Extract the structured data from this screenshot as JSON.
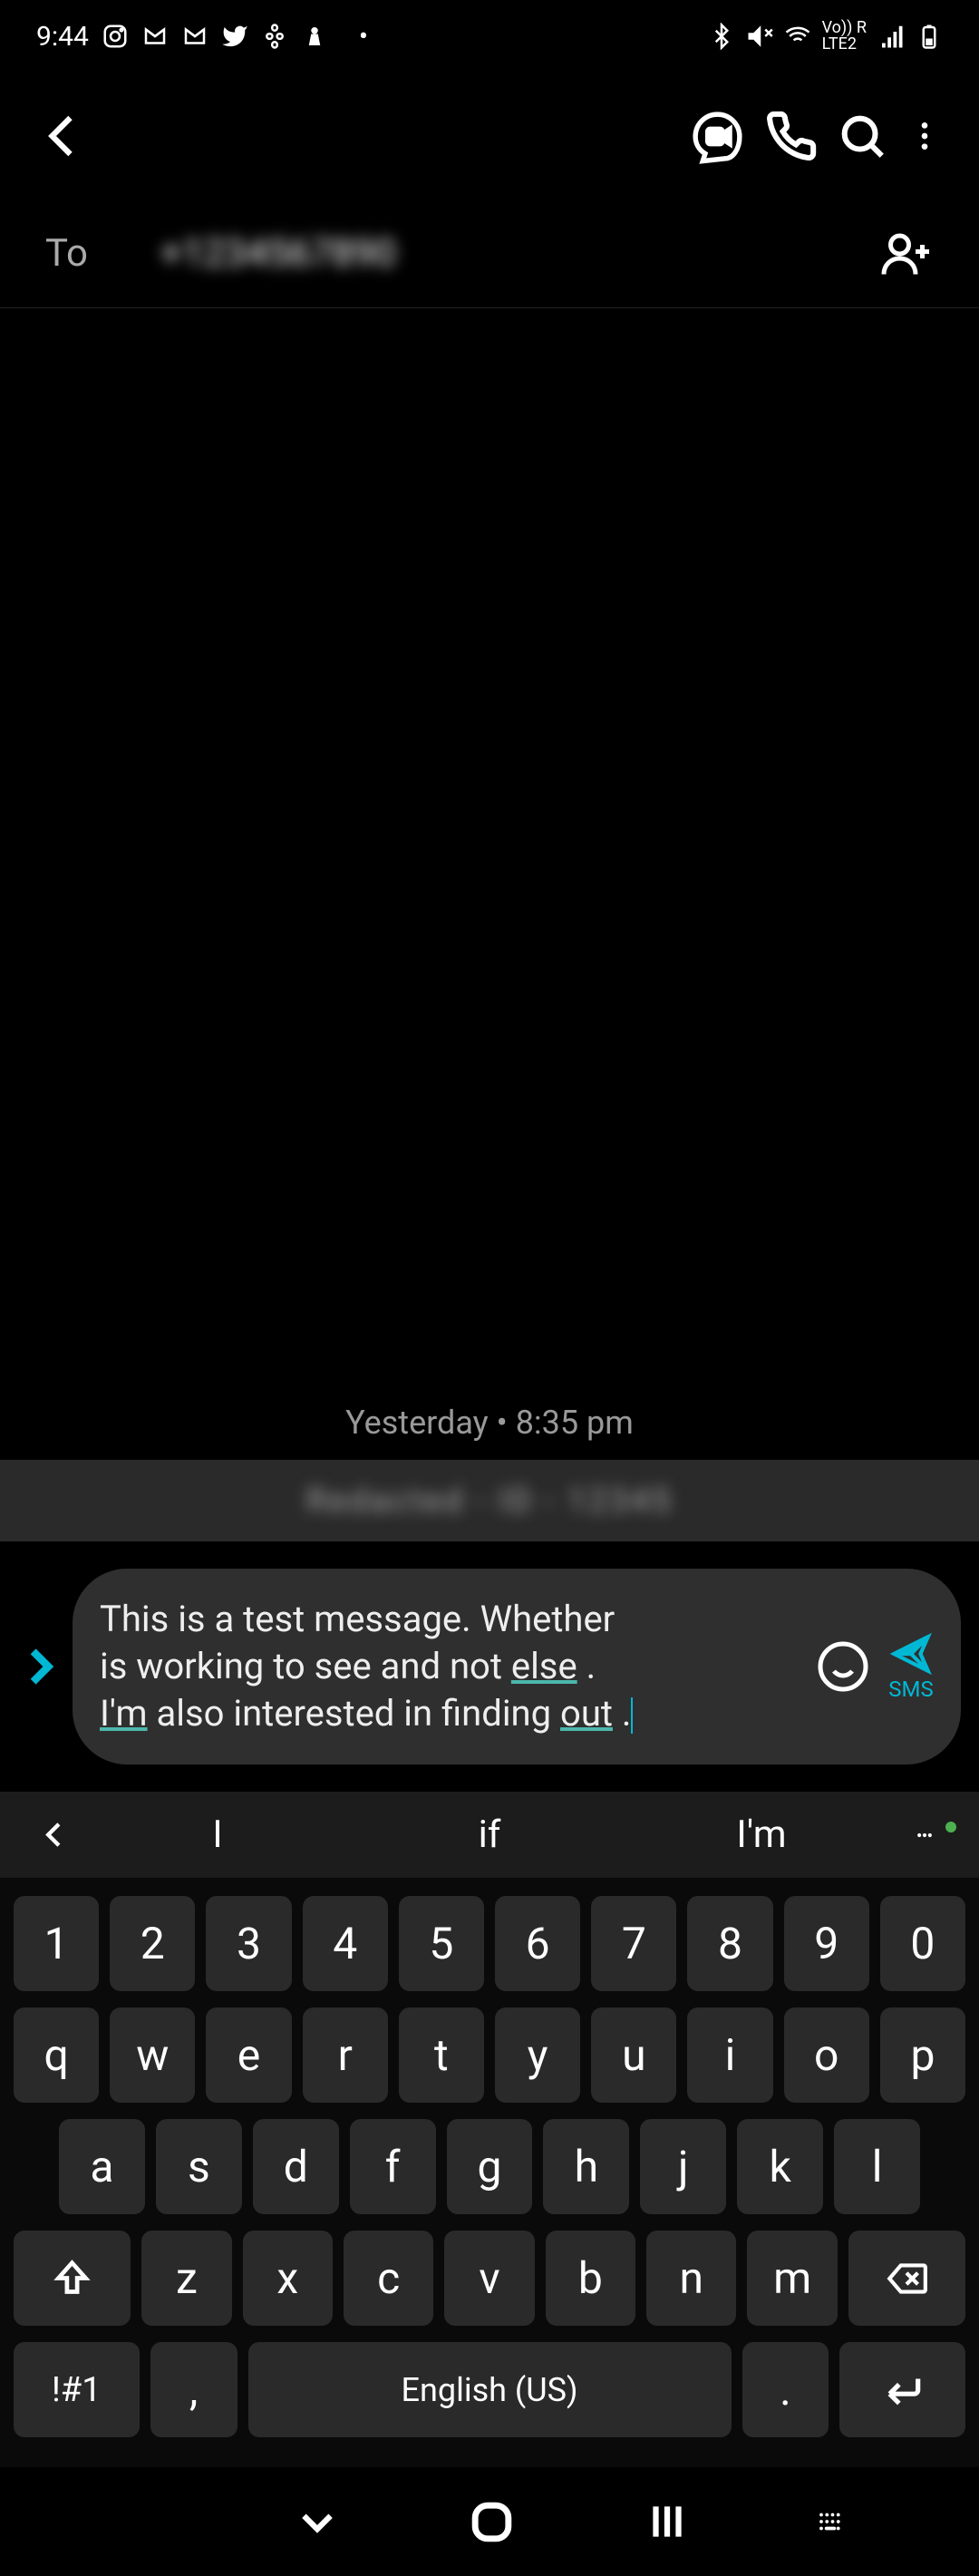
{
  "status": {
    "time": "9:44",
    "lte_label": "LTE2",
    "vo_r": "Vo)) R"
  },
  "toolbar": {},
  "recipient": {
    "label": "To",
    "value": "+1234567890"
  },
  "conversation": {
    "timestamp": "Yesterday • 8:35 pm",
    "redacted": "Redacted - ID - 12345"
  },
  "compose": {
    "line1": "This is a test message.  Whether",
    "line2_a": "is working to see and not ",
    "line2_u": "else",
    "line2_b": " .",
    "line3_u1": "I'm",
    "line3_a": " also interested in finding ",
    "line3_u2": "out",
    "line3_b": " .",
    "send_label": "SMS"
  },
  "suggestions": {
    "s1": "I",
    "s2": "if",
    "s3": "I'm"
  },
  "keyboard": {
    "row1": [
      "1",
      "2",
      "3",
      "4",
      "5",
      "6",
      "7",
      "8",
      "9",
      "0"
    ],
    "row2": [
      "q",
      "w",
      "e",
      "r",
      "t",
      "y",
      "u",
      "i",
      "o",
      "p"
    ],
    "row3": [
      "a",
      "s",
      "d",
      "f",
      "g",
      "h",
      "j",
      "k",
      "l"
    ],
    "row4": [
      "z",
      "x",
      "c",
      "v",
      "b",
      "n",
      "m"
    ],
    "symbols": "!#1",
    "comma": ",",
    "space": "English (US)",
    "period": "."
  }
}
